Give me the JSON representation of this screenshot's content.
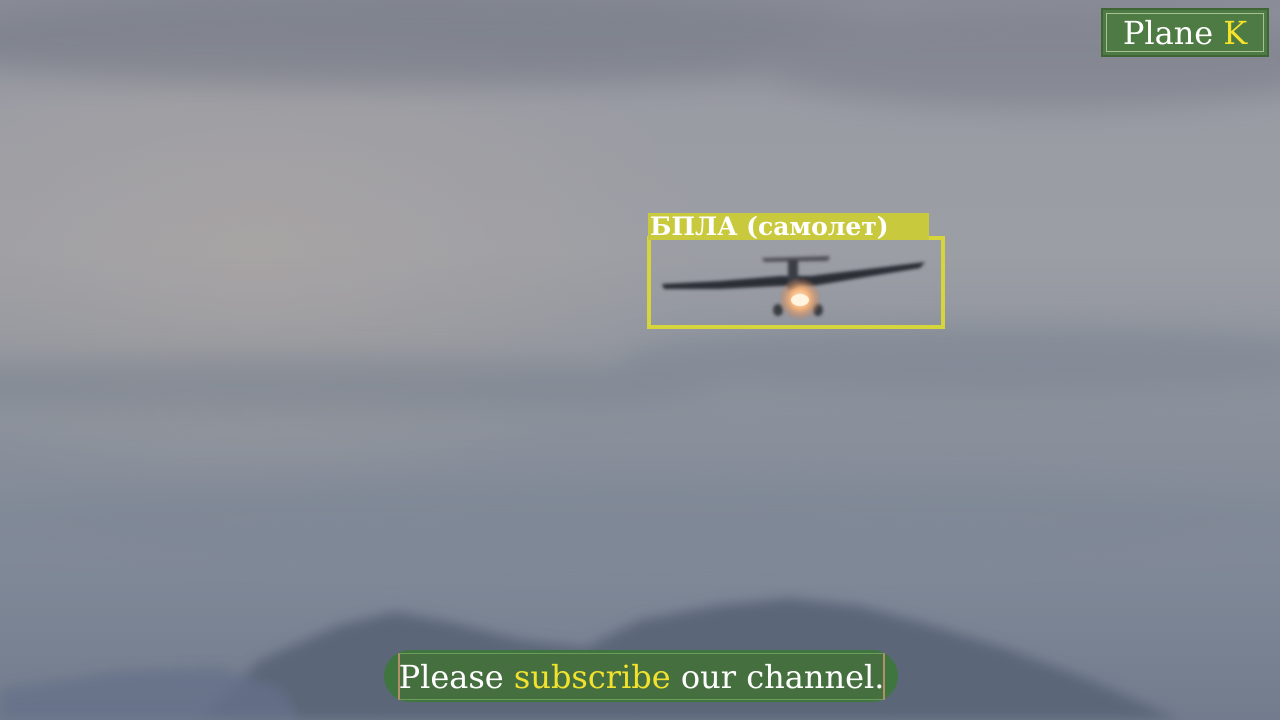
{
  "watermark": {
    "name": "Plane",
    "letter": "K"
  },
  "detection": {
    "label": "БПЛА (самолет)",
    "box_color": "#d6d63c"
  },
  "banner": {
    "before": "Please",
    "highlight": "subscribe",
    "after": "our channel."
  },
  "colors": {
    "banner_green": "#3f7640",
    "highlight_yellow": "#f2e22e",
    "sky": "#8e929c"
  }
}
